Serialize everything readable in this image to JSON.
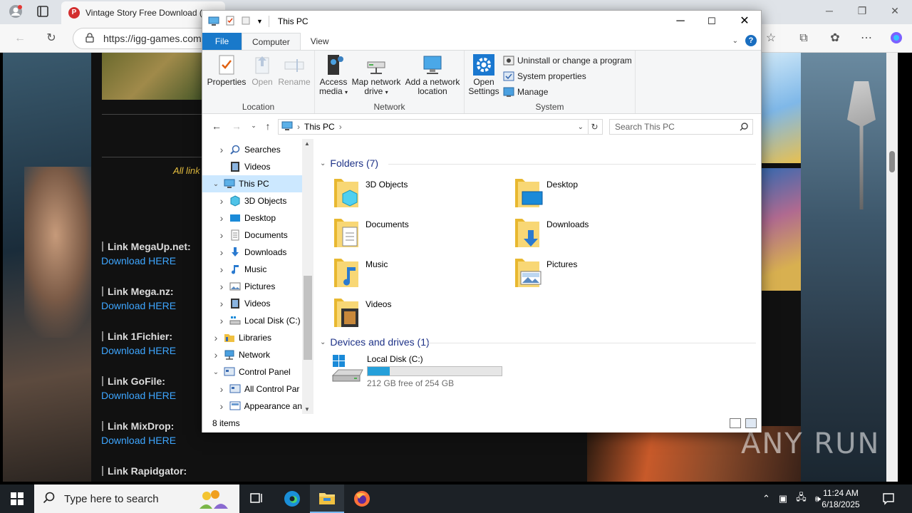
{
  "browser": {
    "tab_title": "Vintage Story Free Download (v",
    "url": "https://igg-games.com",
    "tab_favicon": "igg-icon"
  },
  "webpage": {
    "all_links": "All link",
    "links": [
      {
        "label": "Link MegaUp.net:",
        "download": "Download HERE"
      },
      {
        "label": "Link Mega.nz:",
        "download": "Download HERE"
      },
      {
        "label": "Link 1Fichier:",
        "download": "Download HERE"
      },
      {
        "label": "Link GoFile:",
        "download": "Download HERE"
      },
      {
        "label": "Link MixDrop:",
        "download": "Download HERE"
      },
      {
        "label": "Link Rapidgator:",
        "download": ""
      }
    ],
    "watermark": "ANY RUN"
  },
  "explorer": {
    "title": "This PC",
    "ribbon_tabs": [
      "File",
      "Computer",
      "View"
    ],
    "ribbon": {
      "location": {
        "label": "Location",
        "properties": "Properties",
        "open": "Open",
        "rename": "Rename"
      },
      "network": {
        "label": "Network",
        "access_media_1": "Access",
        "access_media_2": "media",
        "map_drive_1": "Map network",
        "map_drive_2": "drive",
        "add_location_1": "Add a network",
        "add_location_2": "location"
      },
      "system": {
        "label": "System",
        "open_settings_1": "Open",
        "open_settings_2": "Settings",
        "uninstall": "Uninstall or change a program",
        "system_properties": "System properties",
        "manage": "Manage"
      }
    },
    "address": {
      "path": "This PC",
      "search_placeholder": "Search This PC"
    },
    "nav_tree": [
      {
        "label": "Searches",
        "indent": 2,
        "chevron": "right"
      },
      {
        "label": "Videos",
        "indent": 2,
        "chevron": ""
      },
      {
        "label": "This PC",
        "indent": 1,
        "chevron": "down"
      },
      {
        "label": "3D Objects",
        "indent": 2,
        "chevron": "right"
      },
      {
        "label": "Desktop",
        "indent": 2,
        "chevron": "right"
      },
      {
        "label": "Documents",
        "indent": 2,
        "chevron": "right"
      },
      {
        "label": "Downloads",
        "indent": 2,
        "chevron": "right"
      },
      {
        "label": "Music",
        "indent": 2,
        "chevron": "right"
      },
      {
        "label": "Pictures",
        "indent": 2,
        "chevron": "right"
      },
      {
        "label": "Videos",
        "indent": 2,
        "chevron": "right"
      },
      {
        "label": "Local Disk (C:)",
        "indent": 2,
        "chevron": "right"
      },
      {
        "label": "Libraries",
        "indent": 1,
        "chevron": "right"
      },
      {
        "label": "Network",
        "indent": 1,
        "chevron": "right"
      },
      {
        "label": "Control Panel",
        "indent": 1,
        "chevron": "down"
      },
      {
        "label": "All Control Par",
        "indent": 2,
        "chevron": "right"
      },
      {
        "label": "Appearance an",
        "indent": 2,
        "chevron": "right"
      }
    ],
    "folders_heading": "Folders (7)",
    "folders": [
      {
        "name": "3D Objects",
        "icon": "3d-objects-icon"
      },
      {
        "name": "Desktop",
        "icon": "desktop-icon"
      },
      {
        "name": "Documents",
        "icon": "documents-icon"
      },
      {
        "name": "Downloads",
        "icon": "downloads-icon"
      },
      {
        "name": "Music",
        "icon": "music-icon"
      },
      {
        "name": "Pictures",
        "icon": "pictures-icon"
      },
      {
        "name": "Videos",
        "icon": "videos-icon"
      }
    ],
    "devices_heading": "Devices and drives (1)",
    "drive": {
      "name": "Local Disk (C:)",
      "free_text": "212 GB free of 254 GB",
      "used_fraction": 0.165
    },
    "status": "8 items"
  },
  "taskbar": {
    "search_placeholder": "Type here to search",
    "time": "11:24 AM",
    "date": "6/18/2025"
  },
  "colors": {
    "accent": "#1979ca",
    "link": "#3ea6ff",
    "folder_yellow": "#f8d775",
    "drive_bar": "#26a0da"
  }
}
